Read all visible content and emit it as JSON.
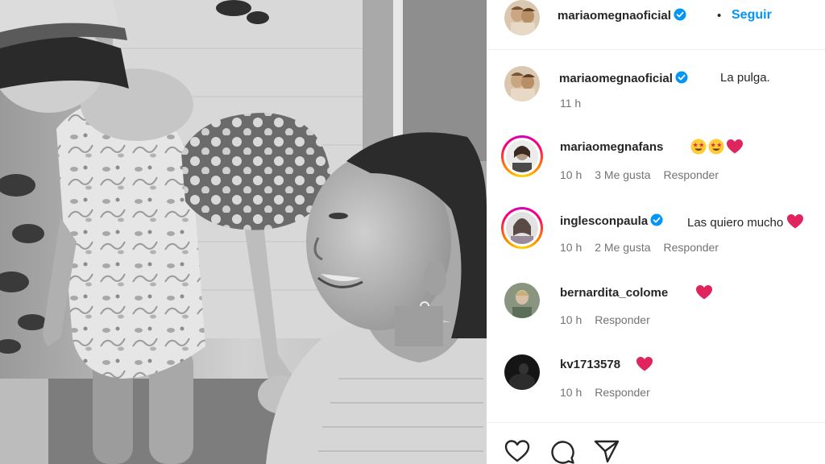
{
  "post": {
    "author": "mariaomegnaoficial",
    "separator": "•",
    "follow_label": "Seguir",
    "caption": {
      "username": "mariaomegnaoficial",
      "text": "La pulga.",
      "time": "11 h"
    }
  },
  "comments": [
    {
      "username": "mariaomegnafans",
      "text": "",
      "emojis": [
        "star-struck-emoji",
        "star-struck-emoji",
        "red-heart-emoji"
      ],
      "time": "10 h",
      "likes": "3 Me gusta",
      "reply_label": "Responder",
      "has_story_ring": true,
      "verified": false
    },
    {
      "username": "inglesconpaula",
      "text": "Las quiero mucho",
      "emojis": [
        "red-heart-emoji"
      ],
      "time": "10 h",
      "likes": "2 Me gusta",
      "reply_label": "Responder",
      "has_story_ring": true,
      "verified": true
    },
    {
      "username": "bernardita_colome",
      "text": "",
      "emojis": [
        "red-heart-emoji"
      ],
      "time": "10 h",
      "likes": "",
      "reply_label": "Responder",
      "has_story_ring": false,
      "verified": false
    },
    {
      "username": "kv1713578",
      "text": "",
      "emojis": [
        "red-heart-emoji"
      ],
      "time": "10 h",
      "likes": "",
      "reply_label": "Responder",
      "has_story_ring": false,
      "verified": false
    }
  ],
  "actions": [
    "heart-icon",
    "comment-icon",
    "share-icon"
  ],
  "colors": {
    "link_blue": "#0095f6",
    "verified_blue": "#0095f6",
    "text_primary": "#262626",
    "text_secondary": "#737373",
    "heart_red": "#e0245e",
    "divider": "#efefef"
  }
}
